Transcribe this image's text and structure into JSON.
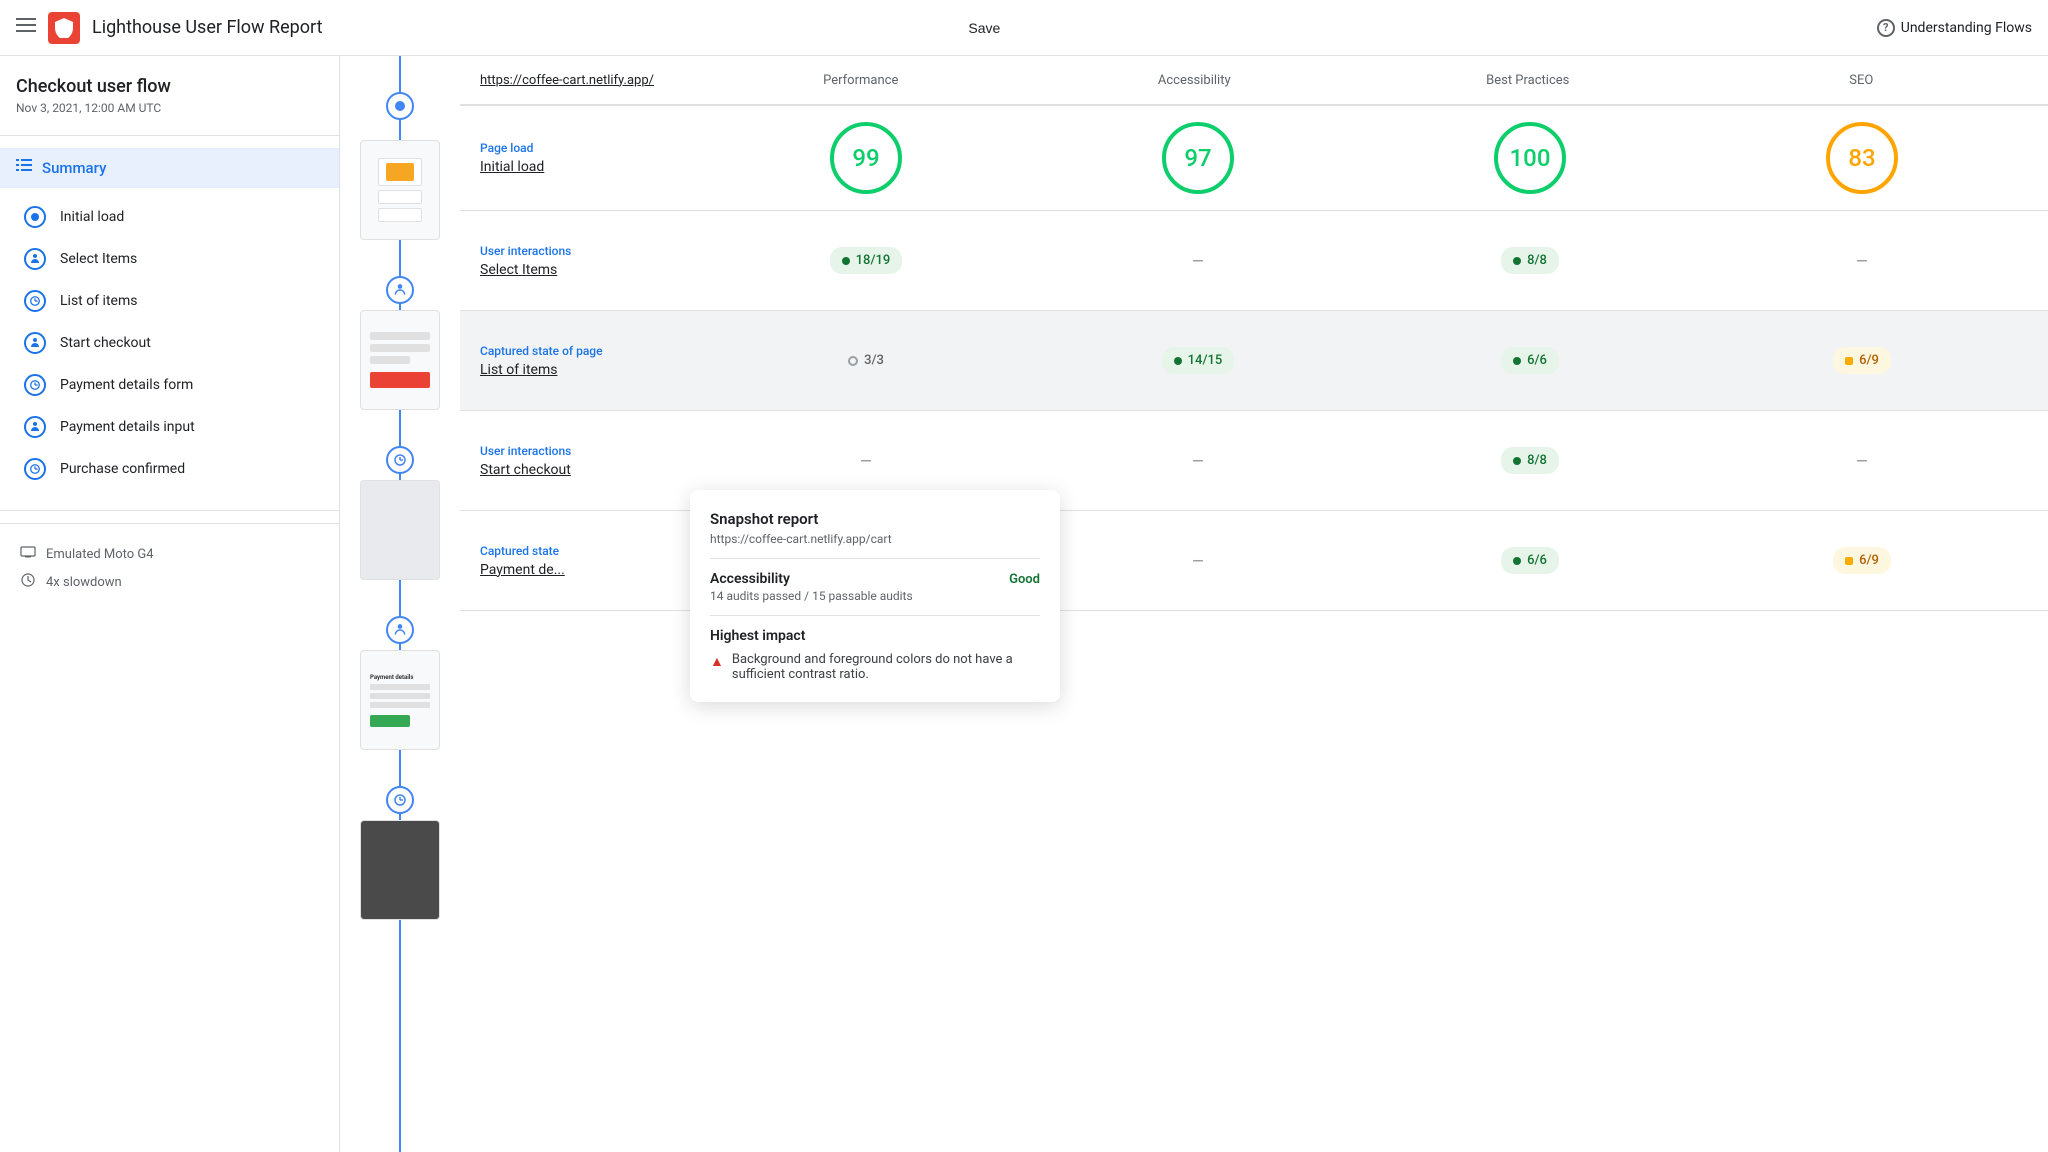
{
  "nav": {
    "hamburger": "☰",
    "title": "Lighthouse User Flow Report",
    "save": "Save",
    "help": "Understanding Flows"
  },
  "sidebar": {
    "title": "Checkout user flow",
    "date": "Nov 3, 2021, 12:00 AM UTC",
    "summary_label": "Summary",
    "steps": [
      {
        "id": "initial-load",
        "label": "Initial load",
        "type": "page-load"
      },
      {
        "id": "select-items",
        "label": "Select Items",
        "type": "user"
      },
      {
        "id": "list-of-items",
        "label": "List of items",
        "type": "snapshot"
      },
      {
        "id": "start-checkout",
        "label": "Start checkout",
        "type": "user"
      },
      {
        "id": "payment-details-form",
        "label": "Payment details form",
        "type": "snapshot"
      },
      {
        "id": "payment-details-input",
        "label": "Payment details input",
        "type": "user"
      },
      {
        "id": "purchase-confirmed",
        "label": "Purchase confirmed",
        "type": "snapshot"
      }
    ],
    "footer": [
      {
        "icon": "▣",
        "label": "Emulated Moto G4"
      },
      {
        "icon": "⚙",
        "label": "4x slowdown"
      }
    ]
  },
  "scores_table": {
    "url": "https://coffee-cart.netlify.app/",
    "col_headers": [
      "Performance",
      "Accessibility",
      "Best Practices",
      "SEO"
    ],
    "rows": [
      {
        "type_label": "Page load",
        "step_name": "Initial load",
        "scores": [
          {
            "kind": "circle",
            "value": "99",
            "color": "green"
          },
          {
            "kind": "circle",
            "value": "97",
            "color": "green"
          },
          {
            "kind": "circle",
            "value": "100",
            "color": "green"
          },
          {
            "kind": "circle",
            "value": "83",
            "color": "orange"
          }
        ]
      },
      {
        "type_label": "User interactions",
        "step_name": "Select Items",
        "scores": [
          {
            "kind": "pill",
            "value": "18/19",
            "color": "green"
          },
          {
            "kind": "dash"
          },
          {
            "kind": "pill",
            "value": "8/8",
            "color": "green"
          },
          {
            "kind": "dash"
          }
        ]
      },
      {
        "type_label": "Captured state of page",
        "step_name": "List of items",
        "highlight": true,
        "scores": [
          {
            "kind": "pill-gray",
            "value": "3/3"
          },
          {
            "kind": "pill",
            "value": "14/15",
            "color": "green"
          },
          {
            "kind": "pill",
            "value": "6/6",
            "color": "green"
          },
          {
            "kind": "pill-orange",
            "value": "6/9"
          }
        ]
      },
      {
        "type_label": "User interactions",
        "step_name": "Start checkout",
        "scores": [
          {
            "kind": "dash"
          },
          {
            "kind": "dash"
          },
          {
            "kind": "pill",
            "value": "8/8",
            "color": "green"
          },
          {
            "kind": "dash"
          }
        ]
      },
      {
        "type_label": "Captured state",
        "step_name": "Payment de...",
        "scores": [
          {
            "kind": "dash"
          },
          {
            "kind": "dash"
          },
          {
            "kind": "pill",
            "value": "6/6",
            "color": "green"
          },
          {
            "kind": "pill-orange",
            "value": "6/9"
          }
        ]
      }
    ]
  },
  "tooltip": {
    "title": "Snapshot report",
    "url": "https://coffee-cart.netlify.app/cart",
    "accessibility_label": "Accessibility",
    "accessibility_status": "Good",
    "accessibility_desc": "14 audits passed / 15 passable audits",
    "highest_impact_label": "Highest impact",
    "impact_item": "Background and foreground colors do not have a sufficient contrast ratio."
  }
}
